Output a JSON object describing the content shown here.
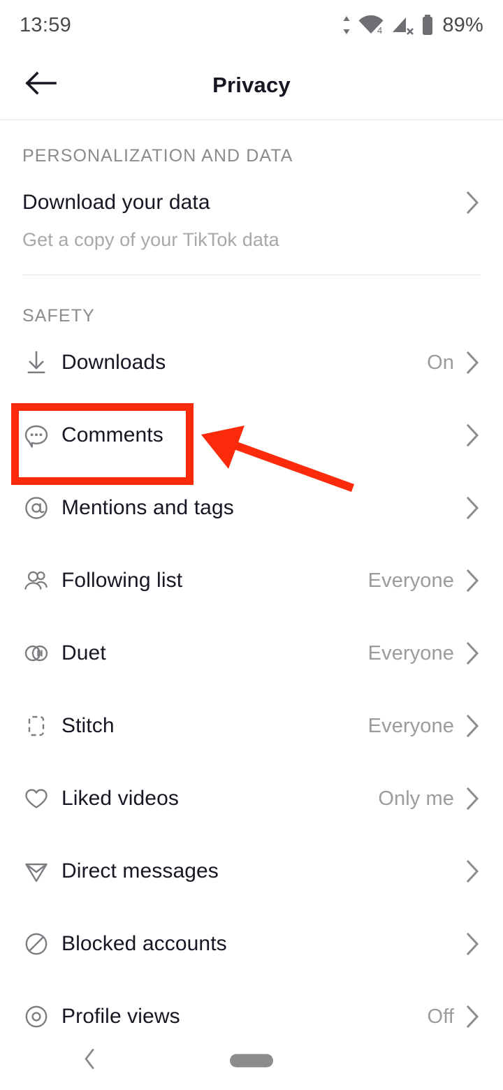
{
  "status_bar": {
    "time": "13:59",
    "battery_percent": "89%",
    "wifi_label": "4",
    "icons": [
      "data-transfer-icon",
      "wifi-icon",
      "cellular-signal-off-icon",
      "battery-icon"
    ]
  },
  "header": {
    "title": "Privacy",
    "back_icon": "back-arrow-icon"
  },
  "sections": [
    {
      "title": "PERSONALIZATION AND DATA",
      "rows": [
        {
          "label": "Download your data",
          "subtitle": "Get a copy of your TikTok data",
          "value": "",
          "icon": "",
          "chevron": true
        }
      ]
    },
    {
      "title": "SAFETY",
      "rows": [
        {
          "label": "Downloads",
          "value": "On",
          "icon": "download-icon",
          "chevron": true
        },
        {
          "label": "Comments",
          "value": "",
          "icon": "comment-bubble-icon",
          "chevron": true
        },
        {
          "label": "Mentions and tags",
          "value": "",
          "icon": "at-mention-icon",
          "chevron": true
        },
        {
          "label": "Following list",
          "value": "Everyone",
          "icon": "people-icon",
          "chevron": true
        },
        {
          "label": "Duet",
          "value": "Everyone",
          "icon": "duet-circles-icon",
          "chevron": true
        },
        {
          "label": "Stitch",
          "value": "Everyone",
          "icon": "stitch-bracket-icon",
          "chevron": true
        },
        {
          "label": "Liked videos",
          "value": "Only me",
          "icon": "heart-icon",
          "chevron": true
        },
        {
          "label": "Direct messages",
          "value": "",
          "icon": "send-plane-icon",
          "chevron": true
        },
        {
          "label": "Blocked accounts",
          "value": "",
          "icon": "block-circle-icon",
          "chevron": true
        },
        {
          "label": "Profile views",
          "value": "Off",
          "icon": "eye-circle-icon",
          "chevron": true
        }
      ]
    }
  ],
  "annotation": {
    "highlight_color": "#FA2A0A",
    "highlight_target": "Comments",
    "arrow": "pointer-arrow"
  },
  "nav_bar": {
    "back_icon": "nav-back-chevron-icon",
    "home_icon": "nav-home-pill-icon"
  },
  "colors": {
    "accent_red": "#FA2A0A",
    "text_primary": "#161722",
    "text_secondary": "#9b9c9f",
    "icon_gray": "#7c7d82",
    "divider": "#e6e6e6"
  }
}
